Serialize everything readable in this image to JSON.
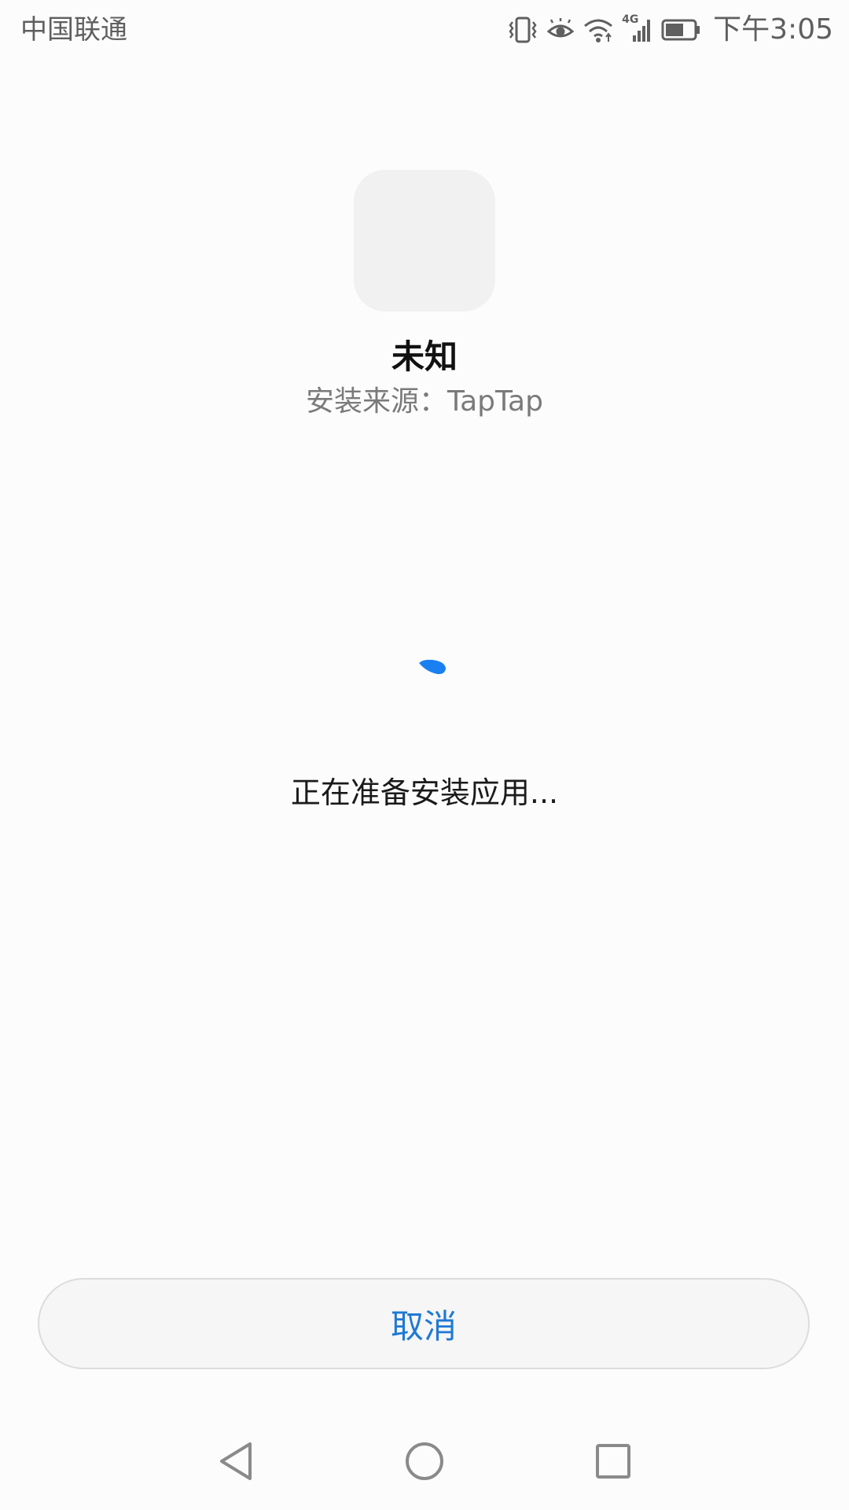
{
  "status_bar": {
    "carrier": "中国联通",
    "time": "下午3:05",
    "icons": [
      "vibrate-icon",
      "eye-comfort-icon",
      "wifi-icon",
      "signal-4g-icon",
      "battery-icon"
    ],
    "network_label": "4G"
  },
  "app": {
    "name": "未知",
    "install_source": "安装来源：TapTap",
    "icon": "app-placeholder-icon"
  },
  "progress": {
    "status_text": "正在准备安装应用...",
    "spinner_color": "#1a7ff0"
  },
  "actions": {
    "cancel_label": "取消",
    "accent_color": "#1f79d4"
  },
  "nav_bar": {
    "icons": [
      "back-icon",
      "home-icon",
      "recents-icon"
    ]
  }
}
